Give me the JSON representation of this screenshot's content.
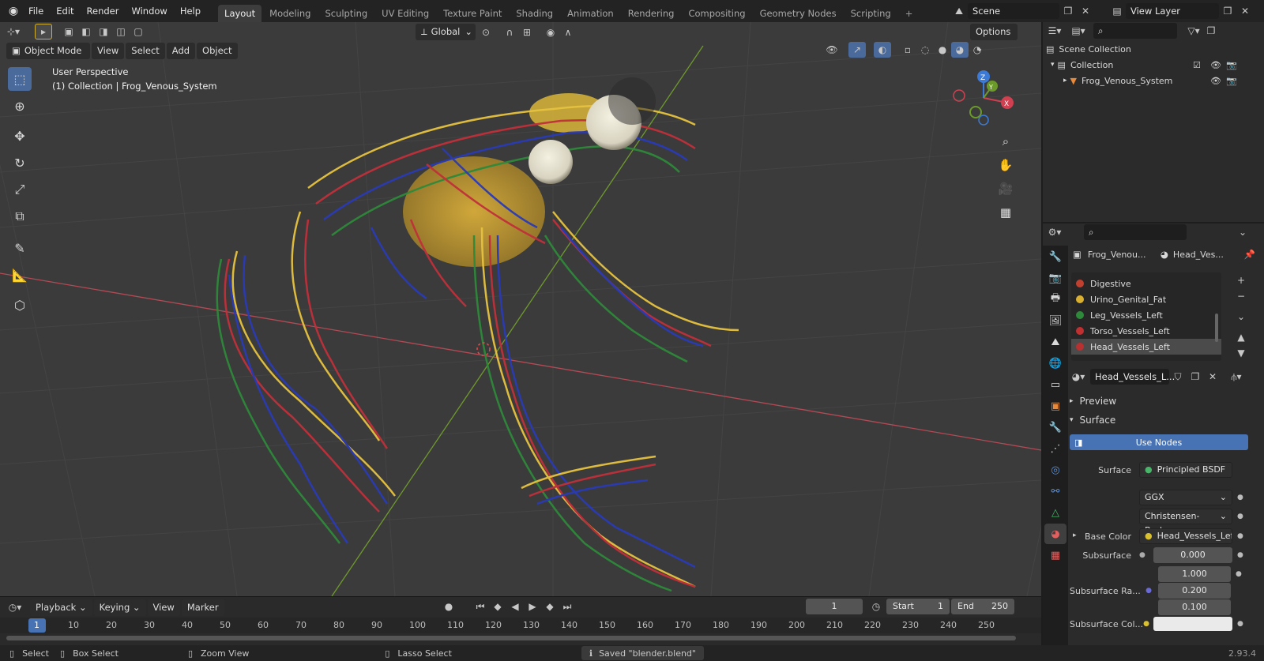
{
  "topbar": {
    "menus": [
      "File",
      "Edit",
      "Render",
      "Window",
      "Help"
    ],
    "workspaces": [
      "Layout",
      "Modeling",
      "Sculpting",
      "UV Editing",
      "Texture Paint",
      "Shading",
      "Animation",
      "Rendering",
      "Compositing",
      "Geometry Nodes",
      "Scripting"
    ],
    "active_workspace": "Layout",
    "scene_name": "Scene",
    "view_layer_name": "View Layer"
  },
  "viewport": {
    "transform_orientation": "Global",
    "options_label": "Options",
    "mode": "Object Mode",
    "menus": [
      "View",
      "Select",
      "Add",
      "Object"
    ],
    "overlay_line1": "User Perspective",
    "overlay_line2": "(1) Collection | Frog_Venous_System",
    "gizmo_axes": {
      "x": "X",
      "y": "Y",
      "z": "Z"
    }
  },
  "outliner": {
    "root": "Scene Collection",
    "collection": "Collection",
    "object": "Frog_Venous_System"
  },
  "properties": {
    "object_name": "Frog_Venou...",
    "material_short": "Head_Ves...",
    "material_slots": [
      {
        "name": "Digestive",
        "color": "#c04030"
      },
      {
        "name": "Urino_Genital_Fat",
        "color": "#d9b030"
      },
      {
        "name": "Leg_Vessels_Left",
        "color": "#2e8a3a"
      },
      {
        "name": "Torso_Vessels_Left",
        "color": "#c03030"
      },
      {
        "name": "Head_Vessels_Left",
        "color": "#b83030"
      }
    ],
    "selected_slot": "Head_Vessels_Left",
    "material_field": "Head_Vessels_L...",
    "panel_preview": "Preview",
    "panel_surface": "Surface",
    "use_nodes_label": "Use Nodes",
    "surface_label": "Surface",
    "surface_value": "Principled BSDF",
    "distribution": "GGX",
    "subsurface_method": "Christensen-Burley",
    "base_color_label": "Base Color",
    "base_color_value": "Head_Vessels_Left...",
    "subsurface_label": "Subsurface",
    "subsurface_value": "0.000",
    "subsurface_radius_label": "Subsurface Ra...",
    "subsurface_radius": [
      "1.000",
      "0.200",
      "0.100"
    ],
    "subsurface_color_label": "Subsurface Col..."
  },
  "timeline": {
    "menus": [
      "Playback",
      "Keying",
      "View",
      "Marker"
    ],
    "current_frame": "1",
    "start_label": "Start",
    "start_value": "1",
    "end_label": "End",
    "end_value": "250",
    "ruler": [
      "1",
      "10",
      "20",
      "30",
      "40",
      "50",
      "60",
      "70",
      "80",
      "90",
      "100",
      "110",
      "120",
      "130",
      "140",
      "150",
      "160",
      "170",
      "180",
      "190",
      "200",
      "210",
      "220",
      "230",
      "240",
      "250"
    ]
  },
  "statusbar": {
    "select": "Select",
    "box_select": "Box Select",
    "zoom_view": "Zoom View",
    "lasso_select": "Lasso Select",
    "message": "Saved \"blender.blend\"",
    "version": "2.93.4"
  },
  "colors": {
    "accent": "#4772b3",
    "x_axis": "#d04050",
    "y_axis": "#6b9a2a",
    "z_axis": "#3b7ad6"
  }
}
